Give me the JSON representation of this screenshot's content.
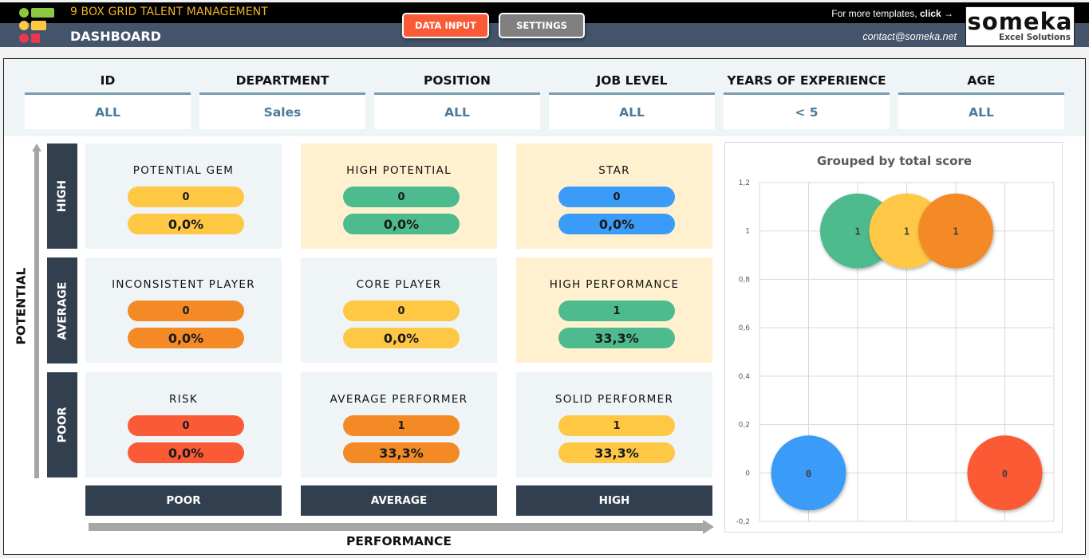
{
  "header": {
    "app_title": "9 BOX GRID TALENT MANAGEMENT",
    "page_title": "DASHBOARD",
    "buttons": {
      "data_input": "DATA INPUT",
      "settings": "SETTINGS"
    },
    "more_templates_prefix": "For more templates, ",
    "more_templates_link": "click →",
    "contact": "contact@someka.net",
    "brand_name": "someka",
    "brand_sub": "Excel Solutions"
  },
  "colors": {
    "header_top": "#000000",
    "header_bottom": "#44546a",
    "data_input": "#fb5a36",
    "settings": "#808080",
    "axis_label_bg": "#323f4f",
    "green": "#4dbb8e",
    "yellow": "#fec744",
    "orange": "#f38a25",
    "red": "#fb5a36",
    "blue": "#3b9bf8"
  },
  "filters": [
    {
      "label": "ID",
      "value": "ALL"
    },
    {
      "label": "DEPARTMENT",
      "value": "Sales"
    },
    {
      "label": "POSITION",
      "value": "ALL"
    },
    {
      "label": "JOB LEVEL",
      "value": "ALL"
    },
    {
      "label": "YEARS OF EXPERIENCE",
      "value": "< 5"
    },
    {
      "label": "AGE",
      "value": "ALL"
    }
  ],
  "grid": {
    "y_axis_title": "POTENTIAL",
    "x_axis_title": "PERFORMANCE",
    "rows": [
      "HIGH",
      "AVERAGE",
      "POOR"
    ],
    "columns": [
      "POOR",
      "AVERAGE",
      "HIGH"
    ],
    "cells": [
      {
        "title": "POTENTIAL GEM",
        "count": "0",
        "percent": "0,0%",
        "color": "#fec744",
        "bg": "gray"
      },
      {
        "title": "HIGH POTENTIAL",
        "count": "0",
        "percent": "0,0%",
        "color": "#4dbb8e",
        "bg": "cream"
      },
      {
        "title": "STAR",
        "count": "0",
        "percent": "0,0%",
        "color": "#3b9bf8",
        "bg": "cream"
      },
      {
        "title": "INCONSISTENT PLAYER",
        "count": "0",
        "percent": "0,0%",
        "color": "#f38a25",
        "bg": "gray"
      },
      {
        "title": "CORE PLAYER",
        "count": "0",
        "percent": "0,0%",
        "color": "#fec744",
        "bg": "gray"
      },
      {
        "title": "HIGH PERFORMANCE",
        "count": "1",
        "percent": "33,3%",
        "color": "#4dbb8e",
        "bg": "cream"
      },
      {
        "title": "RISK",
        "count": "0",
        "percent": "0,0%",
        "color": "#fb5a36",
        "bg": "gray"
      },
      {
        "title": "AVERAGE PERFORMER",
        "count": "1",
        "percent": "33,3%",
        "color": "#f38a25",
        "bg": "gray"
      },
      {
        "title": "SOLID PERFORMER",
        "count": "1",
        "percent": "33,3%",
        "color": "#fec744",
        "bg": "gray"
      }
    ]
  },
  "chart_data": {
    "type": "scatter",
    "subtype": "bubble",
    "title": "Grouped by total score",
    "xlabel": "",
    "ylabel": "",
    "xlim": [
      0,
      6
    ],
    "ylim": [
      -0.2,
      1.2
    ],
    "y_ticks": [
      "-0,2",
      "0",
      "0,2",
      "0,4",
      "0,6",
      "0,8",
      "1",
      "1,2"
    ],
    "y_tick_values": [
      -0.2,
      0,
      0.2,
      0.4,
      0.6,
      0.8,
      1,
      1.2
    ],
    "x_gridlines": [
      0,
      1,
      2,
      3,
      4,
      5,
      6
    ],
    "grid": true,
    "legend": "none",
    "points": [
      {
        "x": 1,
        "y": 0,
        "label": "0",
        "color": "#3b9bf8"
      },
      {
        "x": 2,
        "y": 1,
        "label": "1",
        "color": "#4dbb8e"
      },
      {
        "x": 3,
        "y": 1,
        "label": "1",
        "color": "#fec744"
      },
      {
        "x": 4,
        "y": 1,
        "label": "1",
        "color": "#f38a25"
      },
      {
        "x": 5,
        "y": 0,
        "label": "0",
        "color": "#fb5a36"
      }
    ]
  }
}
